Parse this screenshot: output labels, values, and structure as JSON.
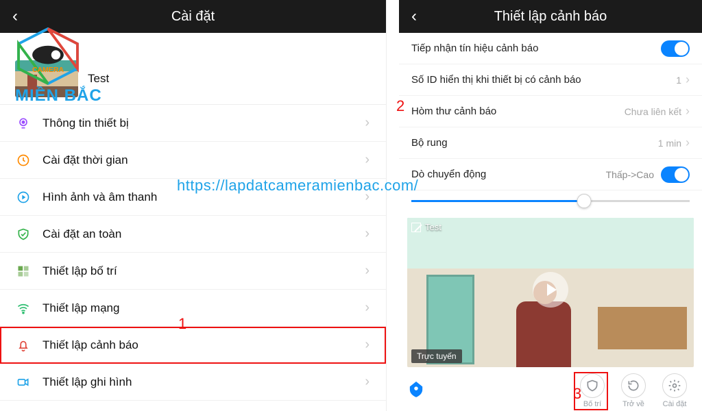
{
  "watermark": {
    "brand": "MIỀN BẮC",
    "url": "https://lapdatcameramienbac.com/"
  },
  "annotations": {
    "one": "1",
    "two": "2",
    "three": "3"
  },
  "left": {
    "header": {
      "title": "Cài đặt"
    },
    "device": {
      "name": "Test"
    },
    "menu": [
      {
        "label": "Thông tin thiết bị",
        "icon": "camera-spot-icon",
        "color": "#9b4dff"
      },
      {
        "label": "Cài đặt thời gian",
        "icon": "clock-icon",
        "color": "#ff8a00"
      },
      {
        "label": "Hình ảnh và âm thanh",
        "icon": "play-circle-icon",
        "color": "#1fa3e8"
      },
      {
        "label": "Cài đặt an toàn",
        "icon": "shield-check-icon",
        "color": "#34b24a"
      },
      {
        "label": "Thiết lập bố trí",
        "icon": "layout-icon",
        "color": "#6aa84f"
      },
      {
        "label": "Thiết lập mạng",
        "icon": "wifi-icon",
        "color": "#2fbf71"
      },
      {
        "label": "Thiết lập cảnh báo",
        "icon": "bell-icon",
        "color": "#e0463a",
        "highlight": true
      },
      {
        "label": "Thiết lập ghi hình",
        "icon": "video-icon",
        "color": "#1fa3e8"
      }
    ]
  },
  "right": {
    "header": {
      "title": "Thiết lập cảnh báo"
    },
    "settings": {
      "receive": {
        "label": "Tiếp nhận tín hiệu cảnh báo",
        "on": true
      },
      "id_count": {
        "label": "Số ID hiển thị khi thiết bị có cảnh báo",
        "value": "1"
      },
      "mailbox": {
        "label": "Hòm thư cảnh báo",
        "value": "Chưa liên kết"
      },
      "vibrate": {
        "label": "Bộ rung",
        "value": "1 min"
      },
      "motion": {
        "label": "Dò chuyển động",
        "value": "Thấp->Cao",
        "on": true
      }
    },
    "preview": {
      "name": "Test",
      "status": "Trực tuyến"
    },
    "bottom": {
      "actions": [
        {
          "label": "Bố trí",
          "icon": "shield-icon"
        },
        {
          "label": "Trở về",
          "icon": "replay-icon"
        },
        {
          "label": "Cài đặt",
          "icon": "gear-icon"
        }
      ]
    }
  }
}
